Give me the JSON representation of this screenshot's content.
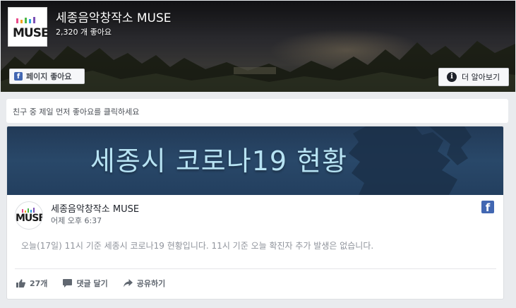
{
  "header": {
    "page_name": "세종음악창작소 MUSE",
    "likes_count": "2,320 개 좋아요",
    "like_button_label": "페이지 좋아요",
    "learn_more_label": "더 알아보기",
    "logo_text": "MUSE",
    "logo_bar_colors": [
      "#e94b8a",
      "#f4a21d",
      "#4cb848",
      "#2f9fe0",
      "#7b4fb5"
    ]
  },
  "social": {
    "prompt": "친구 중 제일 먼저 좋아요를 클릭하세요"
  },
  "post": {
    "banner_text": "세종시 코로나19 현황",
    "author": "세종음악창작소 MUSE",
    "timestamp": "어제 오후 6:37",
    "body": "오늘(17일) 11시 기준 세종시 코로나19 현황입니다. 11시 기준 오늘 확진자 추가 발생은 없습니다.",
    "actions": {
      "like_count": "27개",
      "comment_label": "댓글 달기",
      "share_label": "공유하기"
    }
  },
  "colors": {
    "facebook_blue": "#4267b2",
    "banner_bg": "#294869",
    "banner_text": "#b7e3f3"
  },
  "icons": {
    "like_page": "facebook-f-icon",
    "learn_more": "info-icon",
    "post_source": "facebook-icon",
    "like": "thumbs-up-icon",
    "comment": "comment-bubble-icon",
    "share": "share-arrow-icon"
  }
}
